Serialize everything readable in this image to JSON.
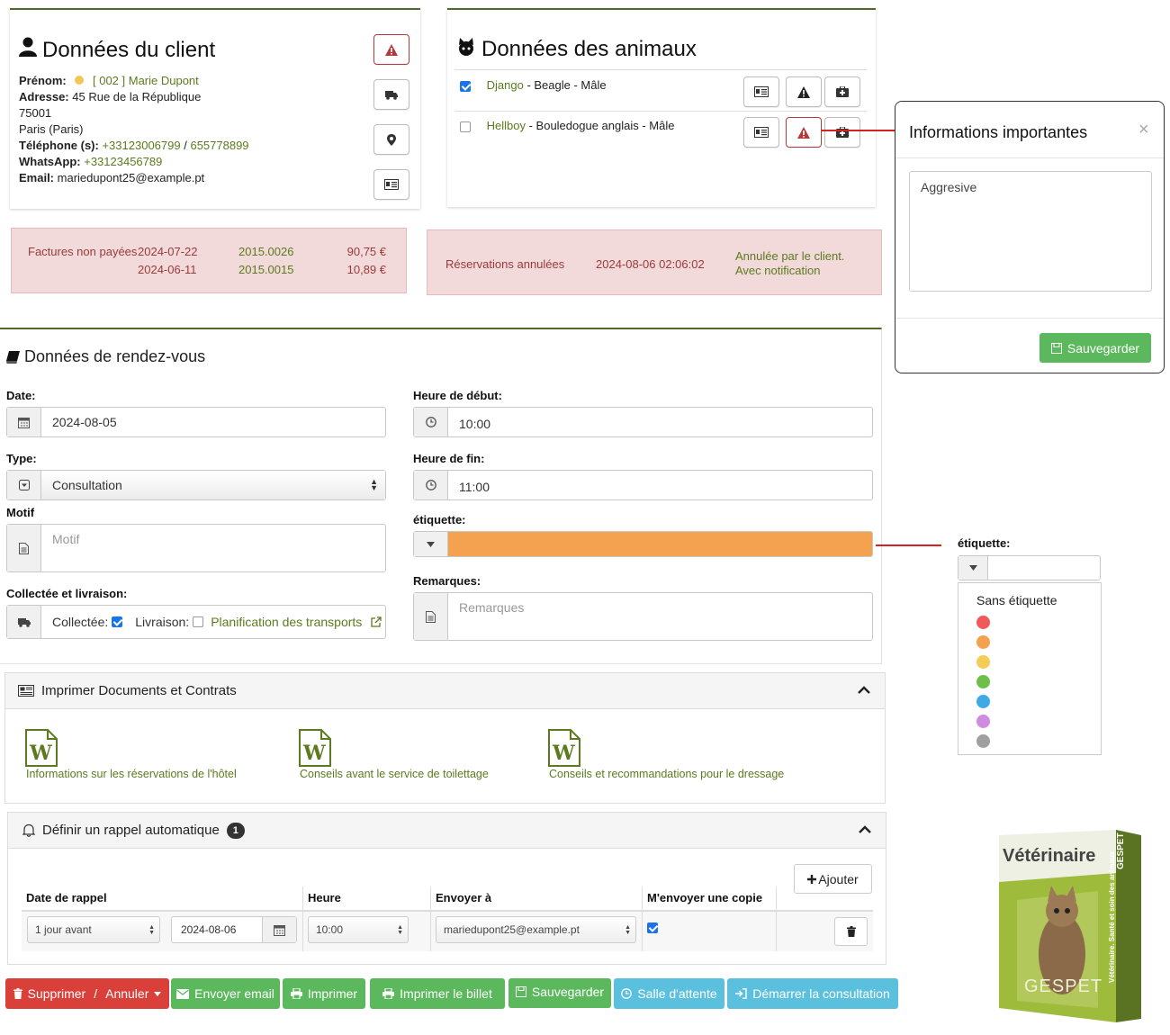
{
  "client": {
    "title": "Données du client",
    "prenom_label": "Prénom:",
    "prenom_value": "[ 002 ] Marie Dupont",
    "adresse_label": "Adresse:",
    "adresse_value": "45 Rue de la République",
    "postal": "75001",
    "city": "Paris (Paris)",
    "phone_label": "Téléphone (s):",
    "phone1": "+33123006799",
    "phone_sep": "/",
    "phone2": "655778899",
    "whatsapp_label": "WhatsApp:",
    "whatsapp_value": "+33123456789",
    "email_label": "Email:",
    "email_value": "mariedupont25@example.pt"
  },
  "animals": {
    "title": "Données des animaux",
    "items": [
      {
        "name": "Django",
        "desc": " - Beagle - Mâle",
        "checked": true
      },
      {
        "name": "Hellboy",
        "desc": " - Bouledogue anglais - Mâle",
        "checked": false
      }
    ]
  },
  "unpaid": {
    "label": "Factures non payées",
    "rows": [
      {
        "date": "2024-07-22",
        "number": "2015.0026",
        "amount": "90,75 €"
      },
      {
        "date": "2024-06-11",
        "number": "2015.0015",
        "amount": "10,89 €"
      }
    ]
  },
  "cancelled": {
    "label": "Réservations annulées",
    "date": "2024-08-06 02:06:02",
    "note1": "Annulée par le client.",
    "note2": "Avec notification"
  },
  "popup": {
    "title": "Informations importantes",
    "close": "×",
    "text": "Aggresive",
    "save": "Sauvegarder"
  },
  "appointment": {
    "title": "Données de rendez-vous",
    "date_label": "Date:",
    "date_value": "2024-08-05",
    "start_label": "Heure de début:",
    "start_value": "10:00",
    "end_label": "Heure de fin:",
    "end_value": "11:00",
    "type_label": "Type:",
    "type_value": "Consultation",
    "motif_label": "Motif",
    "motif_placeholder": "Motif",
    "tag_label": "étiquette:",
    "tag_color": "#f4a24f",
    "remarks_label": "Remarques:",
    "remarks_placeholder": "Remarques",
    "pickup_label": "Collectée et livraison:",
    "collected": "Collectée:",
    "delivery": "Livraison:",
    "transport_link": "Planification des transports"
  },
  "tag_dropdown": {
    "label": "étiquette:",
    "none": "Sans étiquette",
    "colors": [
      "#f05a5a",
      "#f4a24f",
      "#f3cd55",
      "#6cc04a",
      "#3fa9e8",
      "#cf8be0",
      "#a0a0a0"
    ]
  },
  "print": {
    "title": "Imprimer Documents et Contrats",
    "docs": [
      "Informations sur les réservations de l'hôtel",
      "Conseils avant le service de toilettage",
      "Conseils et recommandations pour le dressage"
    ],
    "doc_letter": "W"
  },
  "reminder": {
    "title": "Définir un rappel automatique",
    "badge": "1",
    "add": "Ajouter",
    "headers": [
      "Date de rappel",
      "Heure",
      "Envoyer à",
      "M'envoyer une copie"
    ],
    "row": {
      "when": "1 jour avant",
      "date": "2024-08-06",
      "time": "10:00",
      "to": "mariedupont25@example.pt"
    }
  },
  "actions": {
    "delete": "Supprimer",
    "slash": "/",
    "cancel": "Annuler",
    "email": "Envoyer email",
    "print": "Imprimer",
    "ticket": "Imprimer le billet",
    "save": "Sauvegarder",
    "waiting": "Salle d'attente",
    "consult": "Démarrer la consultation"
  },
  "product_box": {
    "title": "Vétérinaire",
    "brand": "GESPET",
    "side": "Vétérinaire. Santé et soin des animaux",
    "side_brand": "GESPET"
  }
}
